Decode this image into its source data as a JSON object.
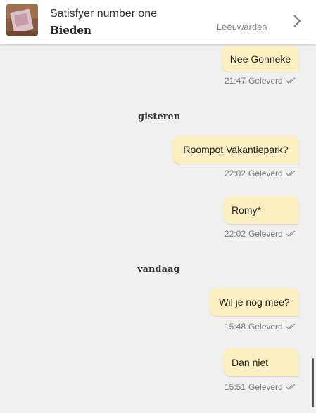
{
  "header": {
    "listing_title": "Satisfyer number one",
    "listing_status": "Bieden",
    "location": "Leeuwarden"
  },
  "messages": [
    {
      "text": "Nee Gonneke",
      "time": "21:47",
      "status": "Geleverd"
    },
    {
      "text": "Roompot Vakantiepark?",
      "time": "22:02",
      "status": "Geleverd"
    },
    {
      "text": "Romy*",
      "time": "22:02",
      "status": "Geleverd"
    },
    {
      "text": "Wil je nog mee?",
      "time": "15:48",
      "status": "Geleverd"
    },
    {
      "text": "Dan niet",
      "time": "15:51",
      "status": "Geleverd"
    }
  ],
  "day_separators": [
    "gisteren",
    "vandaag"
  ],
  "colors": {
    "bubble": "#fcf0c3",
    "background": "#f0f0f0",
    "header": "#ffffff"
  }
}
